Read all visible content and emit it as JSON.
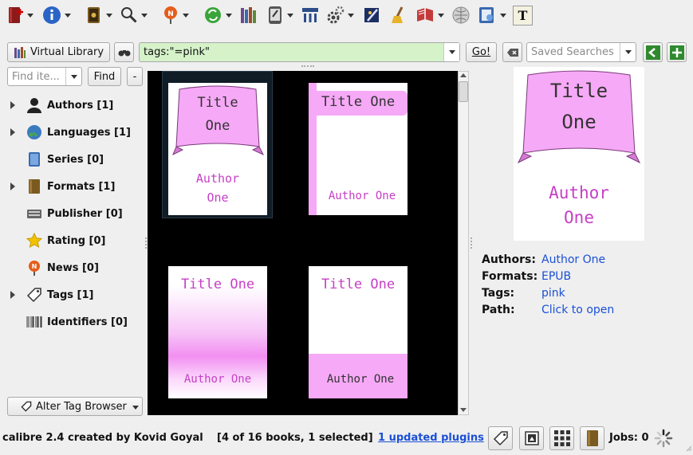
{
  "toolbar": {
    "items": [
      {
        "icon": "add-books-icon"
      },
      {
        "icon": "book-info-icon"
      },
      {
        "icon": "convert-books-icon"
      },
      {
        "icon": "search-books-icon"
      },
      {
        "icon": "fetch-news-icon"
      },
      {
        "icon": "remove-books-icon"
      },
      {
        "icon": "library-icon"
      },
      {
        "icon": "send-to-device-icon"
      },
      {
        "icon": "connect-share-icon"
      },
      {
        "icon": "preferences-icon"
      },
      {
        "icon": "edit-book-icon"
      },
      {
        "icon": "polish-books-icon"
      },
      {
        "icon": "view-book-icon"
      },
      {
        "icon": "wikipedia-icon"
      },
      {
        "icon": "open-book-folder-icon"
      },
      {
        "icon": "text-tool-icon"
      }
    ]
  },
  "search": {
    "virtual_library_label": "Virtual Library",
    "query": "tags:\"=pink\"",
    "go_label": "Go!",
    "saved_searches_placeholder": "Saved Searches"
  },
  "tag_browser": {
    "find_placeholder": "Find ite...",
    "find_label": "Find",
    "collapse_label": "-",
    "items": [
      {
        "label": "Authors [1]",
        "expandable": true,
        "icon": "author-icon"
      },
      {
        "label": "Languages [1]",
        "expandable": true,
        "icon": "languages-icon"
      },
      {
        "label": "Series [0]",
        "expandable": false,
        "icon": "series-icon"
      },
      {
        "label": "Formats [1]",
        "expandable": true,
        "icon": "formats-icon"
      },
      {
        "label": "Publisher [0]",
        "expandable": false,
        "icon": "publisher-icon"
      },
      {
        "label": "Rating [0]",
        "expandable": false,
        "icon": "rating-star-icon"
      },
      {
        "label": "News [0]",
        "expandable": false,
        "icon": "news-icon"
      },
      {
        "label": "Tags [1]",
        "expandable": true,
        "icon": "tag-icon"
      },
      {
        "label": "Identifiers [0]",
        "expandable": false,
        "icon": "barcode-icon"
      }
    ],
    "alter_label": "Alter Tag Browser"
  },
  "covers": [
    {
      "title_line1": "Title",
      "title_line2": "One",
      "author_line1": "Author",
      "author_line2": "One",
      "style": "banner"
    },
    {
      "title": "Title One",
      "author": "Author One",
      "style": "side-stripe"
    },
    {
      "title": "Title One",
      "author": "Author One",
      "style": "gradient"
    },
    {
      "title": "Title One",
      "author": "Author One",
      "style": "bottom-band"
    }
  ],
  "details": {
    "cover": {
      "title_line1": "Title",
      "title_line2": "One",
      "author_line1": "Author",
      "author_line2": "One"
    },
    "authors_label": "Authors:",
    "authors": "Author One",
    "formats_label": "Formats:",
    "formats": "EPUB",
    "tags_label": "Tags:",
    "tags": "pink",
    "path_label": "Path:",
    "path": "Click to open"
  },
  "status": {
    "app_text": "calibre 2.4 created by Kovid Goyal",
    "count_text": "[4 of 16 books, 1 selected]",
    "updates_link": "1 updated plugins",
    "jobs_text": "Jobs: 0"
  },
  "colors": {
    "accent_pink": "#e58be5",
    "cover_text": "#c63fc6",
    "link_blue": "#1a4fd6",
    "search_bg": "#d5f2c9"
  }
}
